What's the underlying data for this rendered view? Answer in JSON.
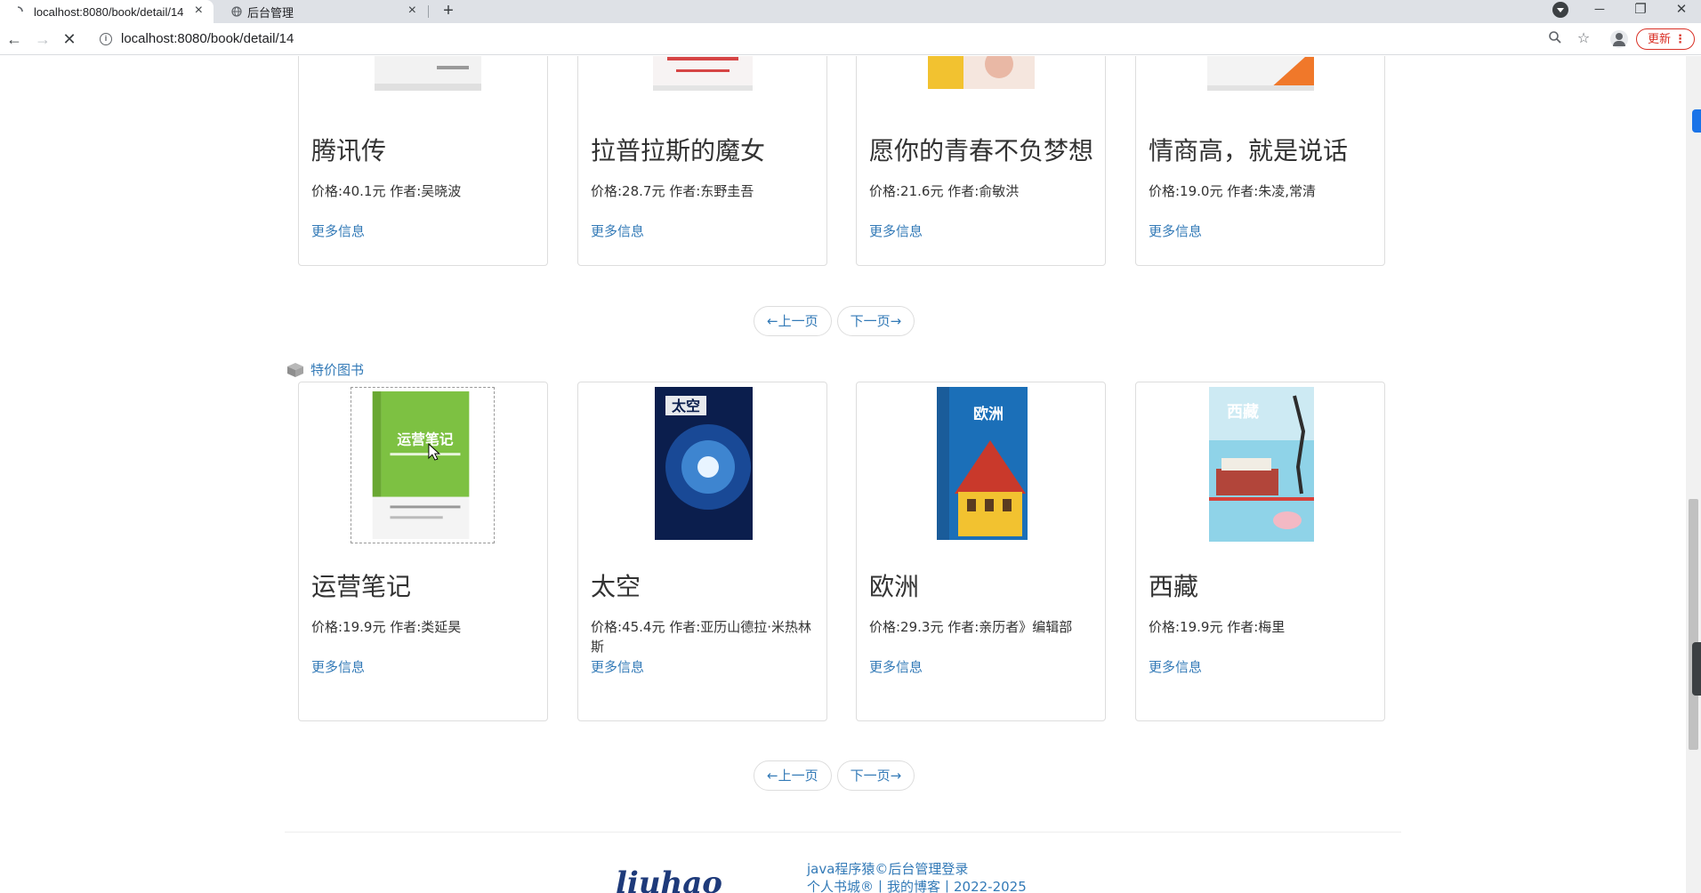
{
  "browser": {
    "tabs": [
      {
        "title": "localhost:8080/book/detail/14",
        "active": true
      },
      {
        "title": "后台管理",
        "active": false
      }
    ],
    "new_tab": "+",
    "url": "localhost:8080/book/detail/14",
    "update_label": "更新",
    "kebab": "⋮",
    "window_controls": {
      "minimize": "─",
      "restore": "❐",
      "close": "✕"
    }
  },
  "recommended_books": [
    {
      "title": "腾讯传",
      "meta": "价格:40.1元  作者:吴晓波",
      "more": "更多信息"
    },
    {
      "title": "拉普拉斯的魔女",
      "meta": "价格:28.7元  作者:东野圭吾",
      "more": "更多信息"
    },
    {
      "title": "愿你的青春不负梦想",
      "meta": "价格:21.6元  作者:俞敏洪",
      "more": "更多信息"
    },
    {
      "title": "情商高，就是说话",
      "meta": "价格:19.0元  作者:朱凌,常清",
      "more": "更多信息"
    }
  ],
  "pager": {
    "prev": "←上一页",
    "next": "下一页→"
  },
  "special_section": {
    "title": "特价图书"
  },
  "special_books": [
    {
      "title": "运营笔记",
      "meta": "价格:19.9元  作者:类延昊",
      "more": "更多信息",
      "cover_text": "运营笔记",
      "cover_color": "#7dc142"
    },
    {
      "title": "太空",
      "meta": "价格:45.4元  作者:亚历山德拉·米热林斯",
      "more": "更多信息",
      "cover_text": "太空",
      "cover_color": "#0b1e4d"
    },
    {
      "title": "欧洲",
      "meta": "价格:29.3元  作者:亲历者》编辑部",
      "more": "更多信息",
      "cover_text": "欧洲",
      "cover_color": "#1b6fb8"
    },
    {
      "title": "西藏",
      "meta": "价格:19.9元  作者:梅里",
      "more": "更多信息",
      "cover_text": "西藏",
      "cover_color": "#8fd3e8"
    }
  ],
  "footer": {
    "logo": "liuhao",
    "line1": "java程序猿©后台管理登录",
    "line2": "个人书城®丨我的博客丨2022-2025"
  },
  "colors": {
    "link": "#337ab7",
    "update": "#d93025"
  }
}
